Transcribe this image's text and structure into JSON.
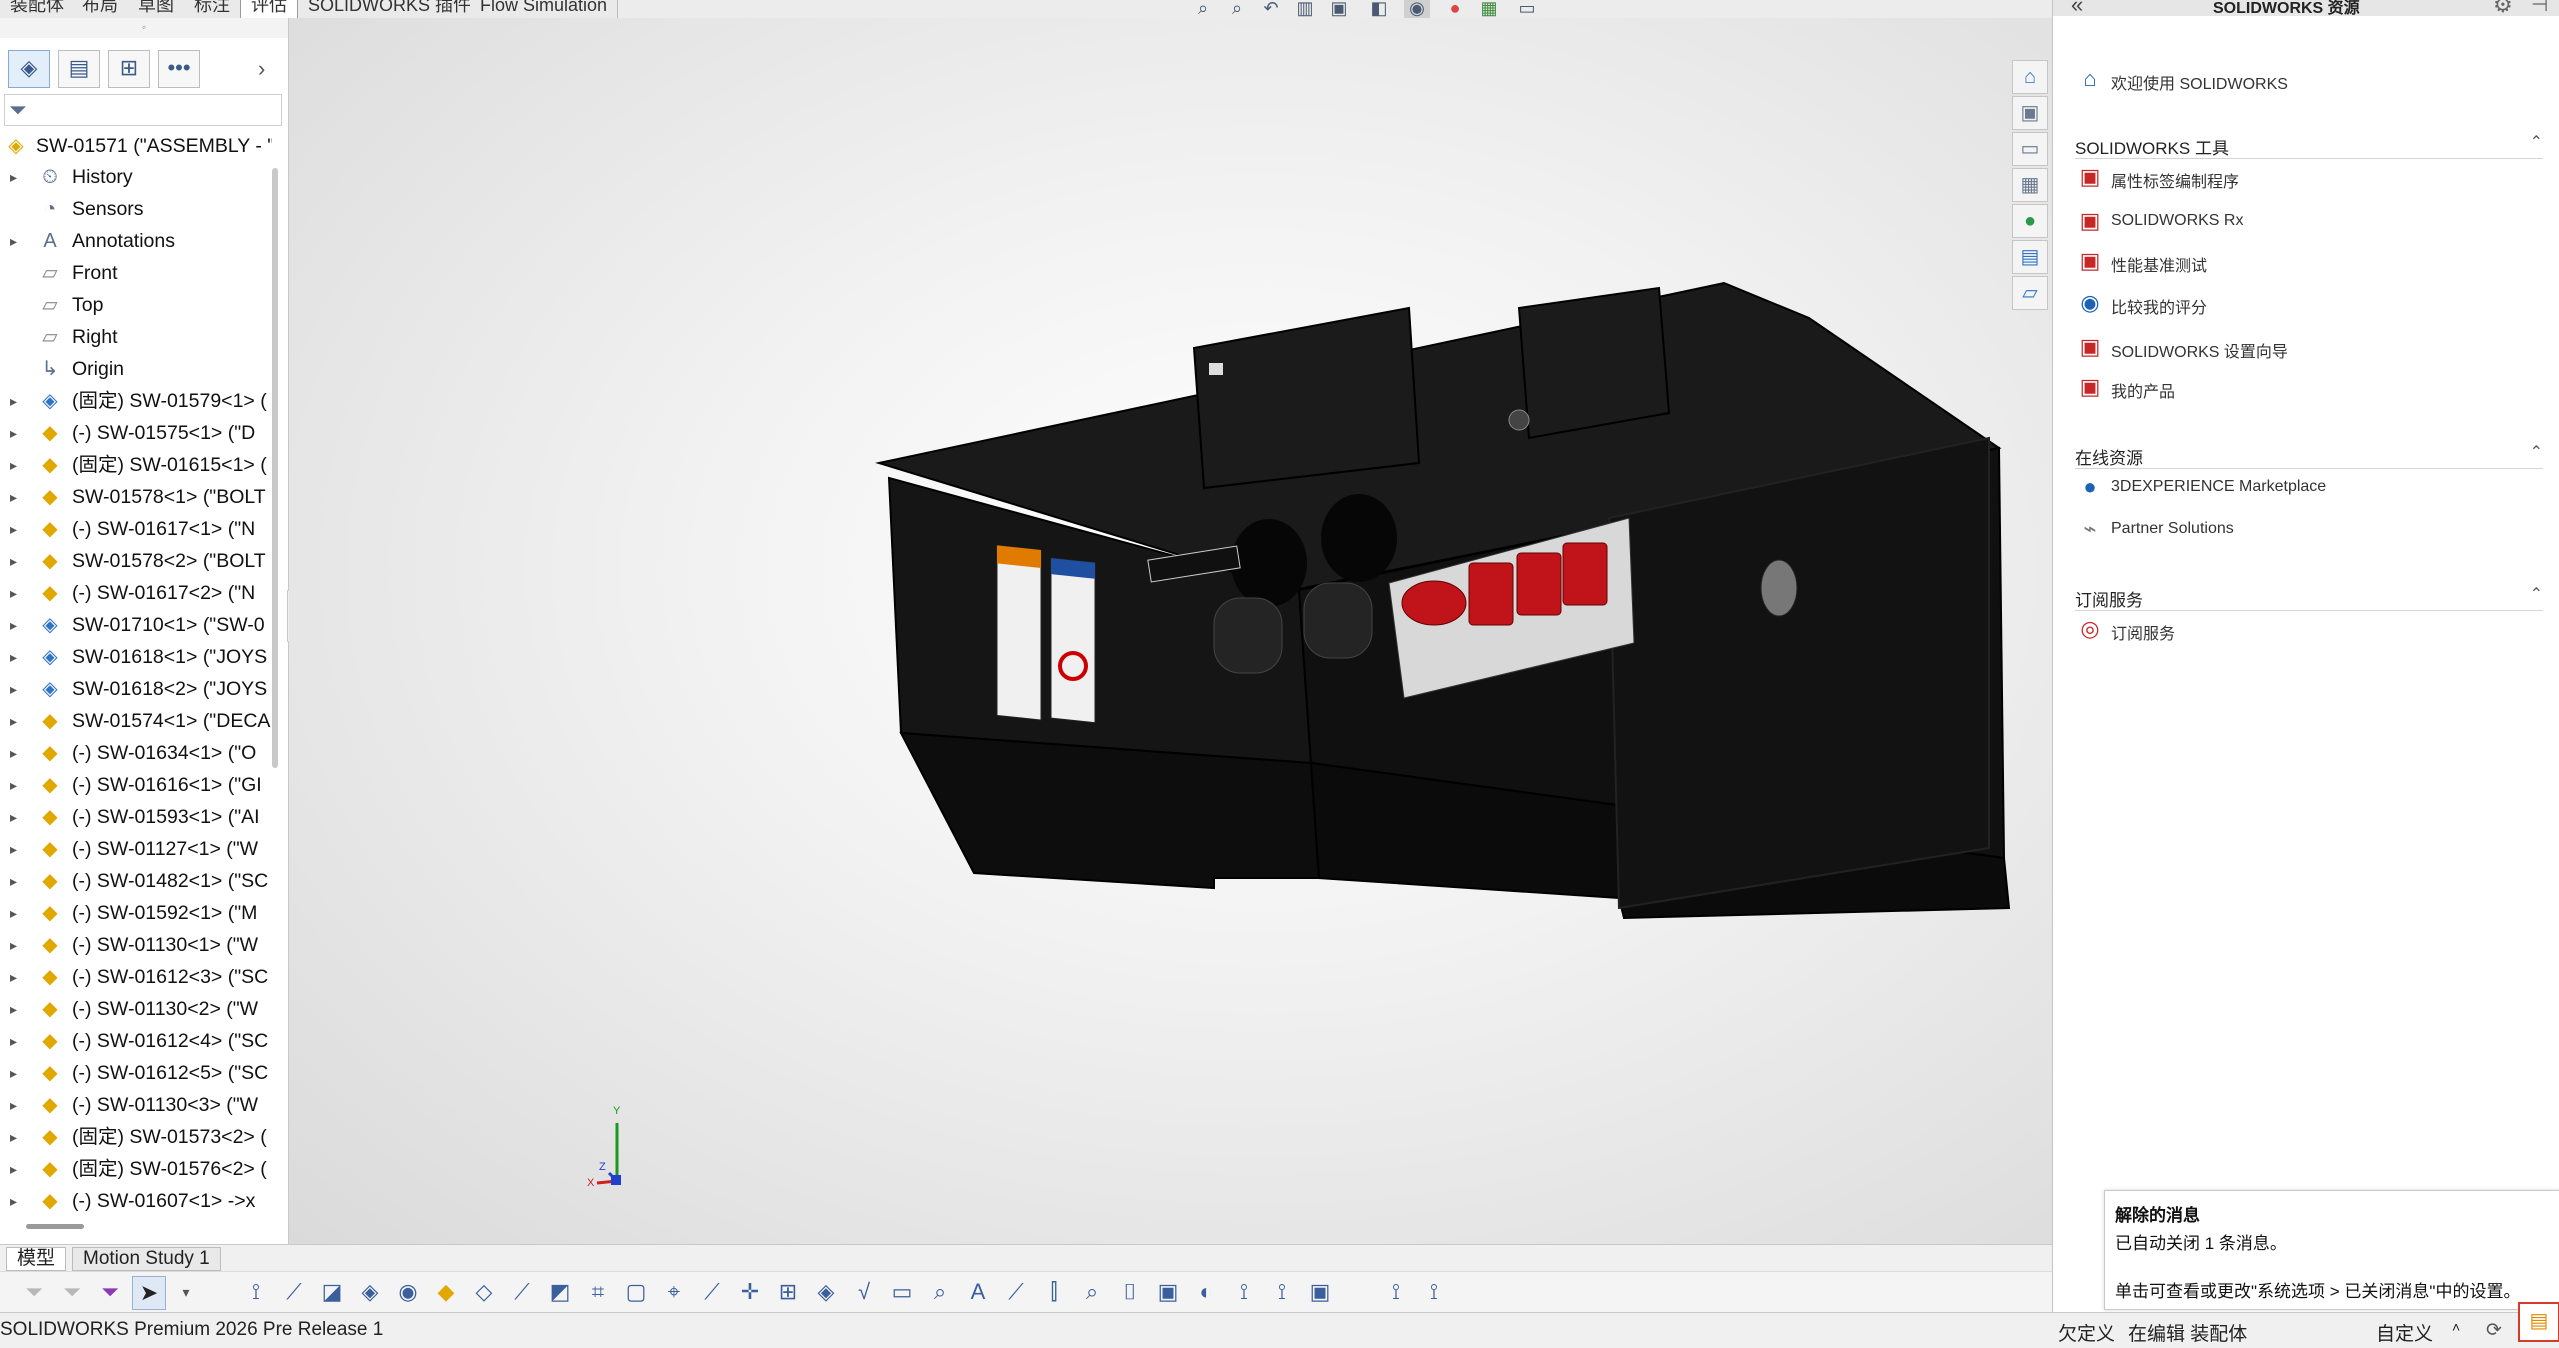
{
  "top_tabs": [
    "装配体",
    "布局",
    "草图",
    "标注",
    "评估",
    "SOLIDWORKS 插件",
    "Flow Simulation"
  ],
  "top_tabs_active": "评估",
  "view_toolbar_icons": [
    "zoom-to-fit-icon",
    "zoom-area-icon",
    "previous-view-icon",
    "section-view-icon",
    "view-orientation-icon",
    "display-style-icon",
    "hide-show-icon",
    "edit-appearance-icon",
    "apply-scene-icon",
    "view-settings-icon",
    "display-icon"
  ],
  "feature_tree": {
    "root": "SW-01571 (\"ASSEMBLY - \"",
    "items": [
      {
        "label": "History",
        "icon": "history-icon",
        "expandable": true
      },
      {
        "label": "Sensors",
        "icon": "sensors-icon",
        "expandable": false
      },
      {
        "label": "Annotations",
        "icon": "annotations-icon",
        "expandable": true
      },
      {
        "label": "Front",
        "icon": "plane-icon",
        "expandable": false
      },
      {
        "label": "Top",
        "icon": "plane-icon",
        "expandable": false
      },
      {
        "label": "Right",
        "icon": "plane-icon",
        "expandable": false
      },
      {
        "label": "Origin",
        "icon": "origin-icon",
        "expandable": false
      },
      {
        "label": "(固定) SW-01579<1> (",
        "icon": "assembly-blue-icon",
        "expandable": true
      },
      {
        "label": "(-) SW-01575<1> (\"D",
        "icon": "part-icon",
        "expandable": true
      },
      {
        "label": "(固定) SW-01615<1> (",
        "icon": "part-icon",
        "expandable": true
      },
      {
        "label": "SW-01578<1> (\"BOLT",
        "icon": "part-icon",
        "expandable": true
      },
      {
        "label": "(-) SW-01617<1> (\"N",
        "icon": "part-icon",
        "expandable": true
      },
      {
        "label": "SW-01578<2> (\"BOLT",
        "icon": "part-icon",
        "expandable": true
      },
      {
        "label": "(-) SW-01617<2> (\"N",
        "icon": "part-icon",
        "expandable": true
      },
      {
        "label": "SW-01710<1> (\"SW-0",
        "icon": "assembly-blue-icon",
        "expandable": true
      },
      {
        "label": "SW-01618<1> (\"JOYS",
        "icon": "assembly-blue-icon",
        "expandable": true
      },
      {
        "label": "SW-01618<2> (\"JOYS",
        "icon": "assembly-blue-icon",
        "expandable": true
      },
      {
        "label": "SW-01574<1> (\"DECA",
        "icon": "part-icon",
        "expandable": true
      },
      {
        "label": "(-) SW-01634<1> (\"O",
        "icon": "part-icon",
        "expandable": true
      },
      {
        "label": "(-) SW-01616<1> (\"GI",
        "icon": "part-icon",
        "expandable": true
      },
      {
        "label": "(-) SW-01593<1> (\"AI",
        "icon": "part-icon",
        "expandable": true
      },
      {
        "label": "(-) SW-01127<1> (\"W",
        "icon": "part-icon",
        "expandable": true
      },
      {
        "label": "(-) SW-01482<1> (\"SC",
        "icon": "part-icon",
        "expandable": true
      },
      {
        "label": "(-) SW-01592<1> (\"M",
        "icon": "part-icon",
        "expandable": true
      },
      {
        "label": "(-) SW-01130<1> (\"W",
        "icon": "part-icon",
        "expandable": true
      },
      {
        "label": "(-) SW-01612<3> (\"SC",
        "icon": "part-icon",
        "expandable": true
      },
      {
        "label": "(-) SW-01130<2> (\"W",
        "icon": "part-icon",
        "expandable": true
      },
      {
        "label": "(-) SW-01612<4> (\"SC",
        "icon": "part-icon",
        "expandable": true
      },
      {
        "label": "(-) SW-01612<5> (\"SC",
        "icon": "part-icon",
        "expandable": true
      },
      {
        "label": "(-) SW-01130<3> (\"W",
        "icon": "part-icon",
        "expandable": true
      },
      {
        "label": "(固定) SW-01573<2> (",
        "icon": "part-icon",
        "expandable": true
      },
      {
        "label": "(固定) SW-01576<2> (",
        "icon": "part-icon",
        "expandable": true
      },
      {
        "label": "(-) SW-01607<1> ->x",
        "icon": "part-icon",
        "expandable": true
      }
    ]
  },
  "triad": {
    "x": "X",
    "y": "Y",
    "z": "Z"
  },
  "task_pane": {
    "title": "SOLIDWORKS 资源",
    "welcome": "欢迎使用  SOLIDWORKS",
    "sections": [
      {
        "title": "SOLIDWORKS 工具",
        "items": [
          {
            "label": "属性标签编制程序",
            "icon": "property-tab-builder-icon"
          },
          {
            "label": "SOLIDWORKS Rx",
            "icon": "solidworks-rx-icon"
          },
          {
            "label": "性能基准测试",
            "icon": "performance-benchmark-icon"
          },
          {
            "label": "比较我的评分",
            "icon": "compare-score-icon"
          },
          {
            "label": "SOLIDWORKS 设置向导",
            "icon": "settings-wizard-icon"
          },
          {
            "label": "我的产品",
            "icon": "my-products-icon"
          }
        ]
      },
      {
        "title": "在线资源",
        "items": [
          {
            "label": "3DEXPERIENCE Marketplace",
            "icon": "marketplace-icon"
          },
          {
            "label": "Partner Solutions",
            "icon": "partner-solutions-icon"
          }
        ]
      },
      {
        "title": "订阅服务",
        "items": [
          {
            "label": "订阅服务",
            "icon": "subscription-icon"
          }
        ]
      }
    ]
  },
  "notice": {
    "title": "解除的消息",
    "line1": "已自动关闭 1 条消息。",
    "line2": "单击可查看或更改\"系统选项 > 已关闭消息\"中的设置。"
  },
  "bottom_tabs": [
    "模型",
    "Motion Study 1"
  ],
  "bottom_tabs_active": "模型",
  "status": {
    "app": "SOLIDWORKS Premium 2026 Pre Release 1",
    "definition": "欠定义",
    "mode": "在编辑 装配体",
    "custom": "自定义"
  },
  "colors": {
    "accent": "#2f74c8",
    "part_yellow": "#e0a800",
    "highlight_red": "#d83a2a",
    "model_black": "#121212",
    "button_red": "#c0141a"
  }
}
